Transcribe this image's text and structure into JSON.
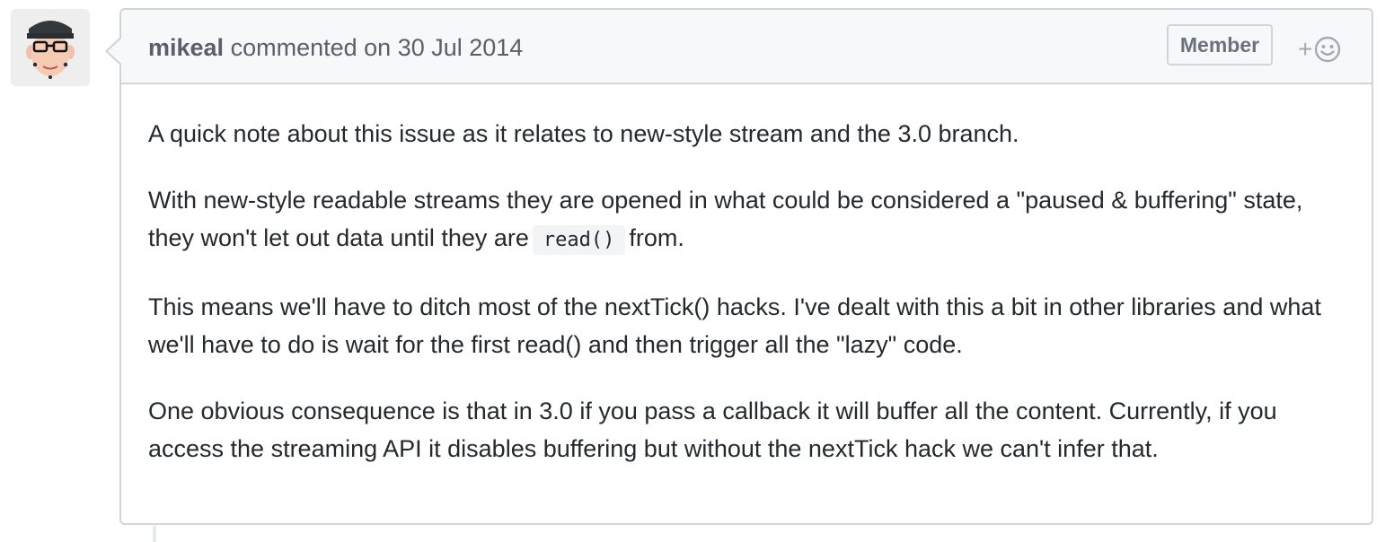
{
  "comment": {
    "author": "mikeal",
    "action_text": "commented on",
    "date": "30 Jul 2014",
    "badge": "Member",
    "reaction_plus": "+",
    "paragraphs": {
      "p1": "A quick note about this issue as it relates to new-style stream and the 3.0 branch.",
      "p2_before": "With new-style readable streams they are opened in what could be considered a \"paused & buffering\" state, they won't let out data until they are",
      "p2_code": "read()",
      "p2_after": "from.",
      "p3": "This means we'll have to ditch most of the nextTick() hacks. I've dealt with this a bit in other libraries and what we'll have to do is wait for the first read() and then trigger all the \"lazy\" code.",
      "p4": "One obvious consequence is that in 3.0 if you pass a callback it will buffer all the content. Currently, if you access the streaming API it disables buffering but without the nextTick hack we can't infer that."
    }
  },
  "icons": {
    "avatar": "user-avatar",
    "reaction": "smiley-icon"
  },
  "colors": {
    "header_bg": "#f6f8fa",
    "border": "#d1d5da",
    "meta_text": "#586069",
    "body_text": "#24292e"
  }
}
